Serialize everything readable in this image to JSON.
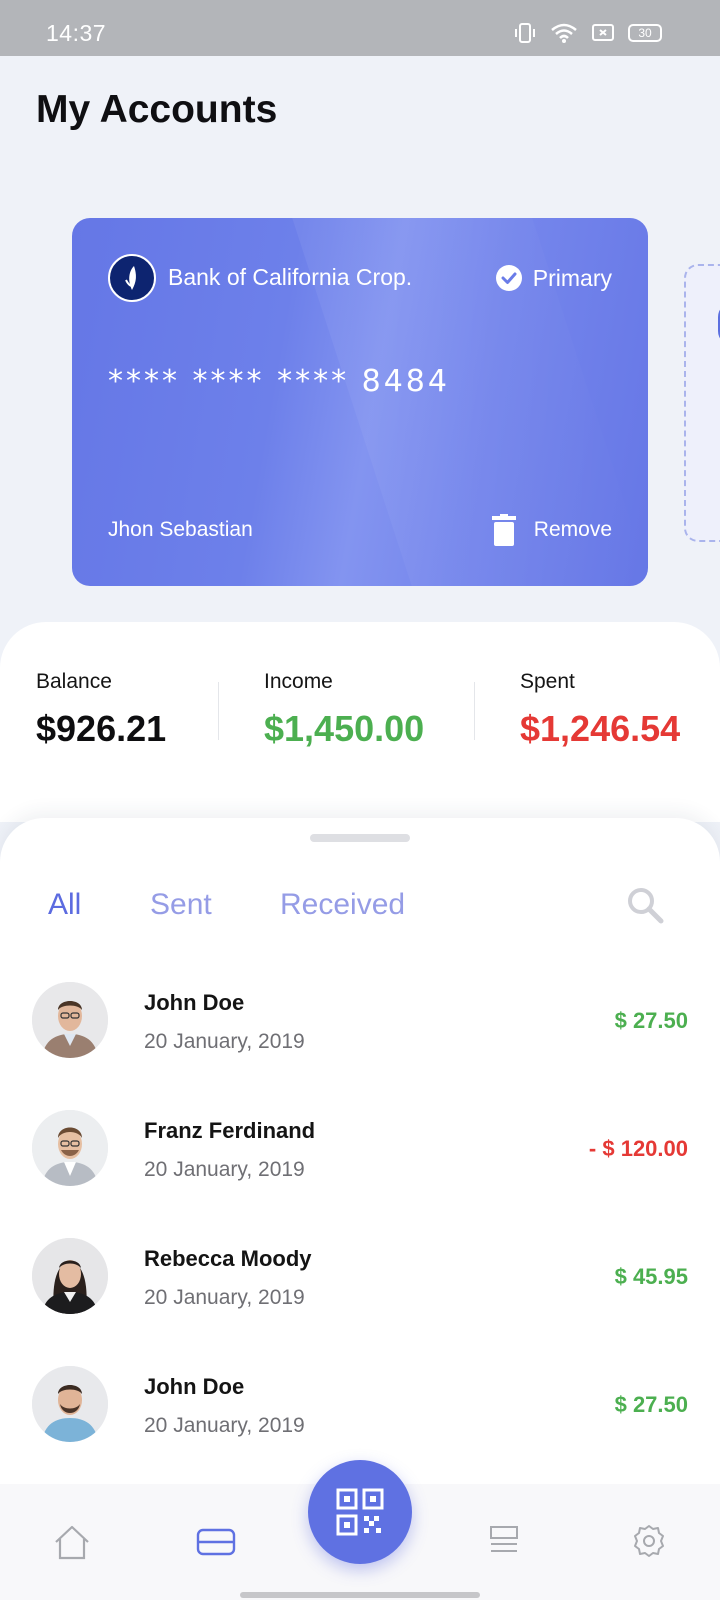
{
  "status_bar": {
    "time": "14:37",
    "battery": "30"
  },
  "page": {
    "title": "My Accounts"
  },
  "card": {
    "bank_name": "Bank of California Crop.",
    "primary_label": "Primary",
    "number": "**** **** **** 8484",
    "holder": "Jhon Sebastian",
    "remove_label": "Remove",
    "color": "#6577e6"
  },
  "stats": {
    "balance": {
      "label": "Balance",
      "value": "$926.21"
    },
    "income": {
      "label": "Income",
      "value": "$1,450.00",
      "color": "#4caf50"
    },
    "spent": {
      "label": "Spent",
      "value": "$1,246.54",
      "color": "#e53935"
    }
  },
  "tabs": [
    {
      "label": "All",
      "active": true
    },
    {
      "label": "Sent",
      "active": false
    },
    {
      "label": "Received",
      "active": false
    }
  ],
  "transactions": [
    {
      "name": "John Doe",
      "date": "20 January, 2019",
      "amount": "$ 27.50",
      "type": "received"
    },
    {
      "name": "Franz Ferdinand",
      "date": "20 January, 2019",
      "amount": "- $ 120.00",
      "type": "sent"
    },
    {
      "name": "Rebecca Moody",
      "date": "20 January, 2019",
      "amount": "$ 45.95",
      "type": "received"
    },
    {
      "name": "John Doe",
      "date": "20 January, 2019",
      "amount": "$ 27.50",
      "type": "received"
    }
  ],
  "nav": {
    "items": [
      {
        "icon": "home-icon"
      },
      {
        "icon": "card-icon",
        "active": true
      },
      {
        "icon": "qr-code-icon"
      },
      {
        "icon": "list-icon"
      },
      {
        "icon": "settings-icon"
      }
    ]
  },
  "colors": {
    "accent": "#5f71e2",
    "positive": "#4caf50",
    "negative": "#e53935"
  }
}
